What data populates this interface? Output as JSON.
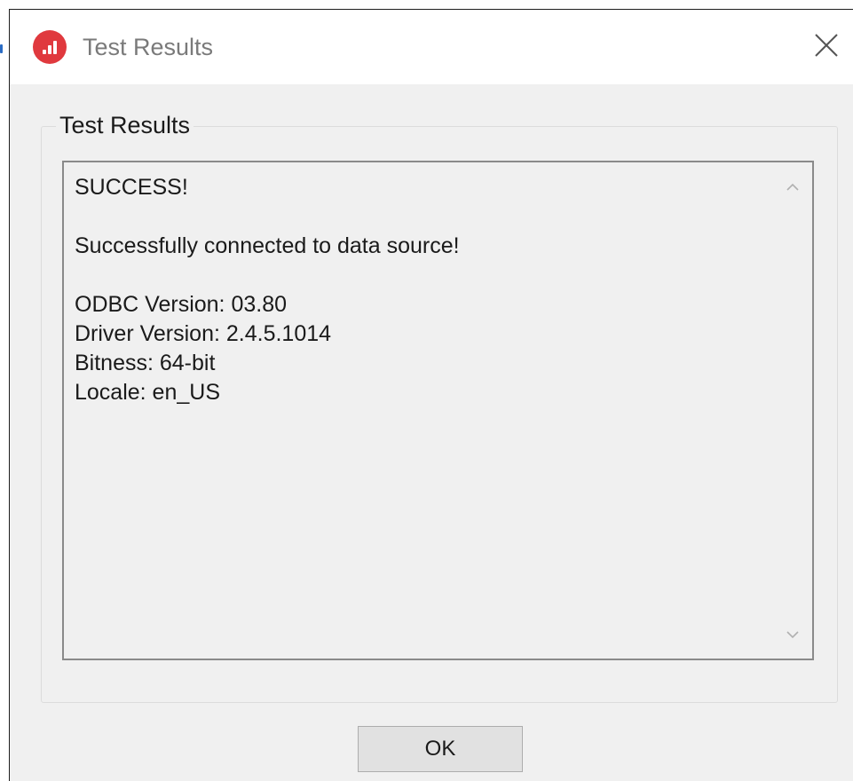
{
  "window": {
    "title": "Test Results",
    "icon": "app-logo-icon",
    "accent_color": "#e0393e"
  },
  "group": {
    "label": "Test Results"
  },
  "results": {
    "lines": [
      "SUCCESS!",
      "",
      "Successfully connected to data source!",
      "",
      "ODBC Version: 03.80",
      "Driver Version: 2.4.5.1014",
      "Bitness: 64-bit",
      "Locale: en_US"
    ]
  },
  "buttons": {
    "ok_label": "OK"
  },
  "icons": {
    "close": "close-icon",
    "scroll_up": "chevron-up-icon",
    "scroll_down": "chevron-down-icon"
  }
}
